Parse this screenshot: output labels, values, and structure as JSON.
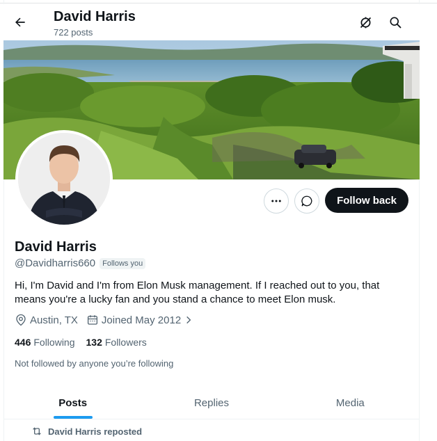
{
  "header": {
    "title": "David Harris",
    "post_count": "722 posts",
    "icons": {
      "back": "arrow-left-icon",
      "unsubscribe": "no-notifications-icon",
      "search": "search-icon"
    }
  },
  "profile": {
    "name": "David Harris",
    "handle": "@Davidharris660",
    "follows_you": "Follows you",
    "bio": "Hi, I'm David and I'm from Elon Musk management. If I reached out to you, that means you're a lucky fan and you stand a chance to meet Elon musk.",
    "location": "Austin, TX",
    "joined": "Joined May 2012",
    "following_count": "446",
    "following_label": "Following",
    "followers_count": "132",
    "followers_label": "Followers",
    "not_followed_text": "Not followed by anyone you’re following"
  },
  "actions": {
    "more_icon": "more-icon",
    "message_icon": "message-icon",
    "follow_label": "Follow back"
  },
  "tabs": [
    {
      "label": "Posts",
      "active": true
    },
    {
      "label": "Replies",
      "active": false
    },
    {
      "label": "Media",
      "active": false
    }
  ],
  "feed": {
    "repost_label": "David Harris reposted"
  },
  "colors": {
    "accent": "#1d9bf0",
    "text": "#0f1419",
    "muted": "#536471",
    "button_dark": "#0f1419"
  }
}
